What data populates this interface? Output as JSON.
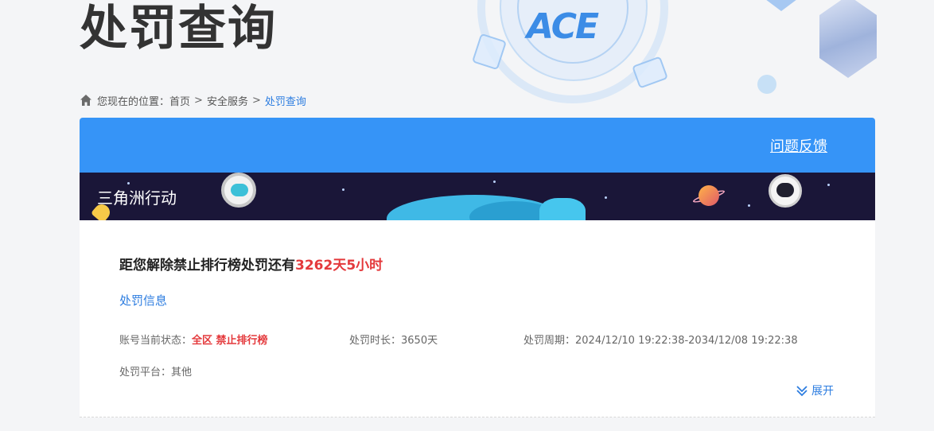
{
  "page": {
    "title": "处罚查询"
  },
  "breadcrumb": {
    "prefix": "您现在的位置：",
    "items": [
      "首页",
      "安全服务"
    ],
    "separator": ">",
    "current": "处罚查询"
  },
  "header": {
    "feedback_link": "问题反馈"
  },
  "banner": {
    "game_name": "三角洲行动",
    "logo_text": "ACE"
  },
  "status": {
    "remaining_prefix": "距您解除禁止排行榜处罚还有",
    "remaining_value": "3262天5小时"
  },
  "info": {
    "section_title": "处罚信息",
    "account_status_label": "账号当前状态：",
    "account_status_value": "全区 禁止排行榜",
    "duration_label": "处罚时长：",
    "duration_value": "3650天",
    "period_label": "处罚周期：",
    "period_value": "2024/12/10 19:22:38-2034/12/08 19:22:38",
    "platform_label": "处罚平台：",
    "platform_value": "其他",
    "expand_label": "展开"
  },
  "colors": {
    "primary": "#3694f7",
    "link": "#2d7de0",
    "highlight": "#e4393c",
    "banner_bg": "#1a1638"
  },
  "icons": [
    "home-icon",
    "chevron-double-down-icon"
  ]
}
